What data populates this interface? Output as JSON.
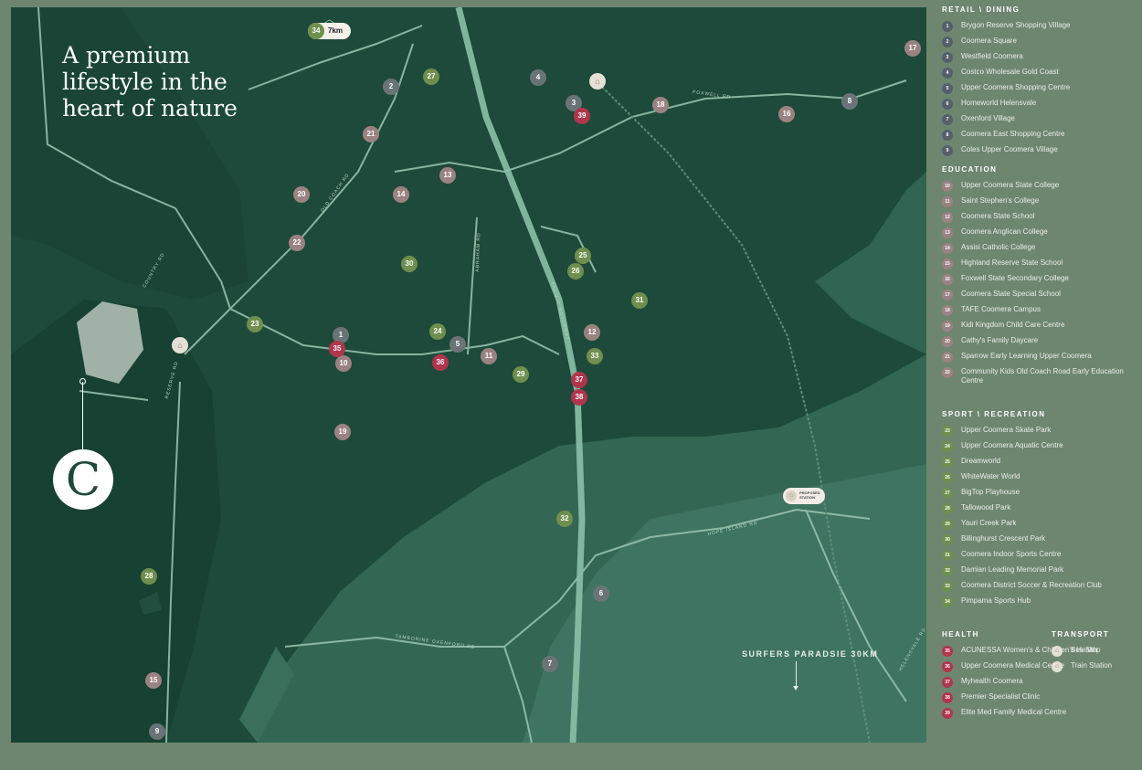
{
  "headline": [
    "A premium",
    "lifestyle in the",
    "heart of nature"
  ],
  "logo_letter": "C",
  "distance_pill": {
    "number": "34",
    "label": "7km"
  },
  "surfers_label": "SURFERS PARADSIE 30KM",
  "proposed_station_label": "PROPOSED STATION",
  "road_labels": [
    "FOXWELL RD",
    "OLD COACH RD",
    "ABRAHAM RD",
    "PACIFIC MOTORWAY",
    "COUNTRY RD",
    "RESERVE RD",
    "HOPE ISLAND RD",
    "TAMBORINE OXENFORD RD",
    "HELENSVALE RD"
  ],
  "colors": {
    "map_bg": "#1d4a3a",
    "retail": "#6a7476",
    "education": "#9b8282",
    "sport": "#6f8f4e",
    "health": "#b0354d",
    "frame": "#6e8670"
  },
  "icons": {
    "transport": "train-icon",
    "bus": "bus-icon"
  },
  "legend": {
    "retail": {
      "title": "RETAIL \\ DINING",
      "items": [
        {
          "n": "1",
          "label": "Brygon Reserve Shopping Village"
        },
        {
          "n": "2",
          "label": "Coomera Square"
        },
        {
          "n": "3",
          "label": "Westfield Coomera"
        },
        {
          "n": "4",
          "label": "Costco Wholesale Gold Coast"
        },
        {
          "n": "5",
          "label": "Upper Coomera Shopping Centre"
        },
        {
          "n": "6",
          "label": "Homeworld Helensvale"
        },
        {
          "n": "7",
          "label": "Oxenford Village"
        },
        {
          "n": "8",
          "label": "Coomera East Shopping Centre"
        },
        {
          "n": "9",
          "label": "Coles Upper Coomera Village"
        }
      ]
    },
    "education": {
      "title": "EDUCATION",
      "items": [
        {
          "n": "10",
          "label": "Upper Coomera State College"
        },
        {
          "n": "11",
          "label": "Saint Stephen's College"
        },
        {
          "n": "12",
          "label": "Coomera State School"
        },
        {
          "n": "13",
          "label": "Coomera Anglican College"
        },
        {
          "n": "14",
          "label": "Assisi Catholic College"
        },
        {
          "n": "15",
          "label": "Highland Reserve State School"
        },
        {
          "n": "16",
          "label": "Foxwell State Secondary College"
        },
        {
          "n": "17",
          "label": "Coomera State Special School"
        },
        {
          "n": "18",
          "label": "TAFE Coomera Campus"
        },
        {
          "n": "19",
          "label": "Kidi Kingdom Child Care Centre"
        },
        {
          "n": "20",
          "label": "Cathy's Family Daycare"
        },
        {
          "n": "21",
          "label": "Sparrow Early Learning Upper Coomera"
        },
        {
          "n": "22",
          "label": "Community Kids Old Coach Road Early Education Centre"
        }
      ]
    },
    "sport": {
      "title": "SPORT \\ RECREATION",
      "items": [
        {
          "n": "23",
          "label": "Upper Coomera Skate Park"
        },
        {
          "n": "24",
          "label": "Upper Coomera Aquatic Centre"
        },
        {
          "n": "25",
          "label": "Dreamworld"
        },
        {
          "n": "26",
          "label": "WhiteWater World"
        },
        {
          "n": "27",
          "label": "BigTop Playhouse"
        },
        {
          "n": "28",
          "label": "Tallowood Park"
        },
        {
          "n": "29",
          "label": "Yauri Creek Park"
        },
        {
          "n": "30",
          "label": "Billinghurst Crescent Park"
        },
        {
          "n": "31",
          "label": "Coomera Indoor Sports Centre"
        },
        {
          "n": "32",
          "label": "Damian Leading Memorial Park"
        },
        {
          "n": "33",
          "label": "Coomera District Soccer & Recreation Club"
        },
        {
          "n": "34",
          "label": "Pimpama Sports Hub"
        }
      ]
    },
    "health": {
      "title": "HEALTH",
      "items": [
        {
          "n": "35",
          "label": "ACUNESSA Women's & Children's Health"
        },
        {
          "n": "36",
          "label": "Upper Coomera Medical Centre"
        },
        {
          "n": "37",
          "label": "Myhealth Coomera"
        },
        {
          "n": "38",
          "label": "Premier Specialist Clinic"
        },
        {
          "n": "39",
          "label": "Elite Med Family Medical Centre"
        }
      ]
    },
    "transport": {
      "title": "TRANSPORT",
      "items": [
        {
          "label": "Bus Stop"
        },
        {
          "label": "Train Station"
        }
      ]
    }
  },
  "map_pins": [
    {
      "n": "1",
      "cat": "retail"
    },
    {
      "n": "2",
      "cat": "retail"
    },
    {
      "n": "3",
      "cat": "retail"
    },
    {
      "n": "4",
      "cat": "retail"
    },
    {
      "n": "5",
      "cat": "retail"
    },
    {
      "n": "6",
      "cat": "retail"
    },
    {
      "n": "7",
      "cat": "retail"
    },
    {
      "n": "8",
      "cat": "retail"
    },
    {
      "n": "9",
      "cat": "retail"
    },
    {
      "n": "10",
      "cat": "edu"
    },
    {
      "n": "11",
      "cat": "edu"
    },
    {
      "n": "12",
      "cat": "edu"
    },
    {
      "n": "13",
      "cat": "edu"
    },
    {
      "n": "14",
      "cat": "edu"
    },
    {
      "n": "15",
      "cat": "edu"
    },
    {
      "n": "16",
      "cat": "edu"
    },
    {
      "n": "17",
      "cat": "edu"
    },
    {
      "n": "18",
      "cat": "edu"
    },
    {
      "n": "19",
      "cat": "edu"
    },
    {
      "n": "20",
      "cat": "edu"
    },
    {
      "n": "21",
      "cat": "edu"
    },
    {
      "n": "22",
      "cat": "edu"
    },
    {
      "n": "23",
      "cat": "sport"
    },
    {
      "n": "24",
      "cat": "sport"
    },
    {
      "n": "25",
      "cat": "sport"
    },
    {
      "n": "26",
      "cat": "sport"
    },
    {
      "n": "27",
      "cat": "sport"
    },
    {
      "n": "28",
      "cat": "sport"
    },
    {
      "n": "29",
      "cat": "sport"
    },
    {
      "n": "30",
      "cat": "sport"
    },
    {
      "n": "31",
      "cat": "sport"
    },
    {
      "n": "32",
      "cat": "sport"
    },
    {
      "n": "33",
      "cat": "sport"
    },
    {
      "n": "35",
      "cat": "health"
    },
    {
      "n": "36",
      "cat": "health"
    },
    {
      "n": "37",
      "cat": "health"
    },
    {
      "n": "38",
      "cat": "health"
    },
    {
      "n": "39",
      "cat": "health"
    }
  ]
}
